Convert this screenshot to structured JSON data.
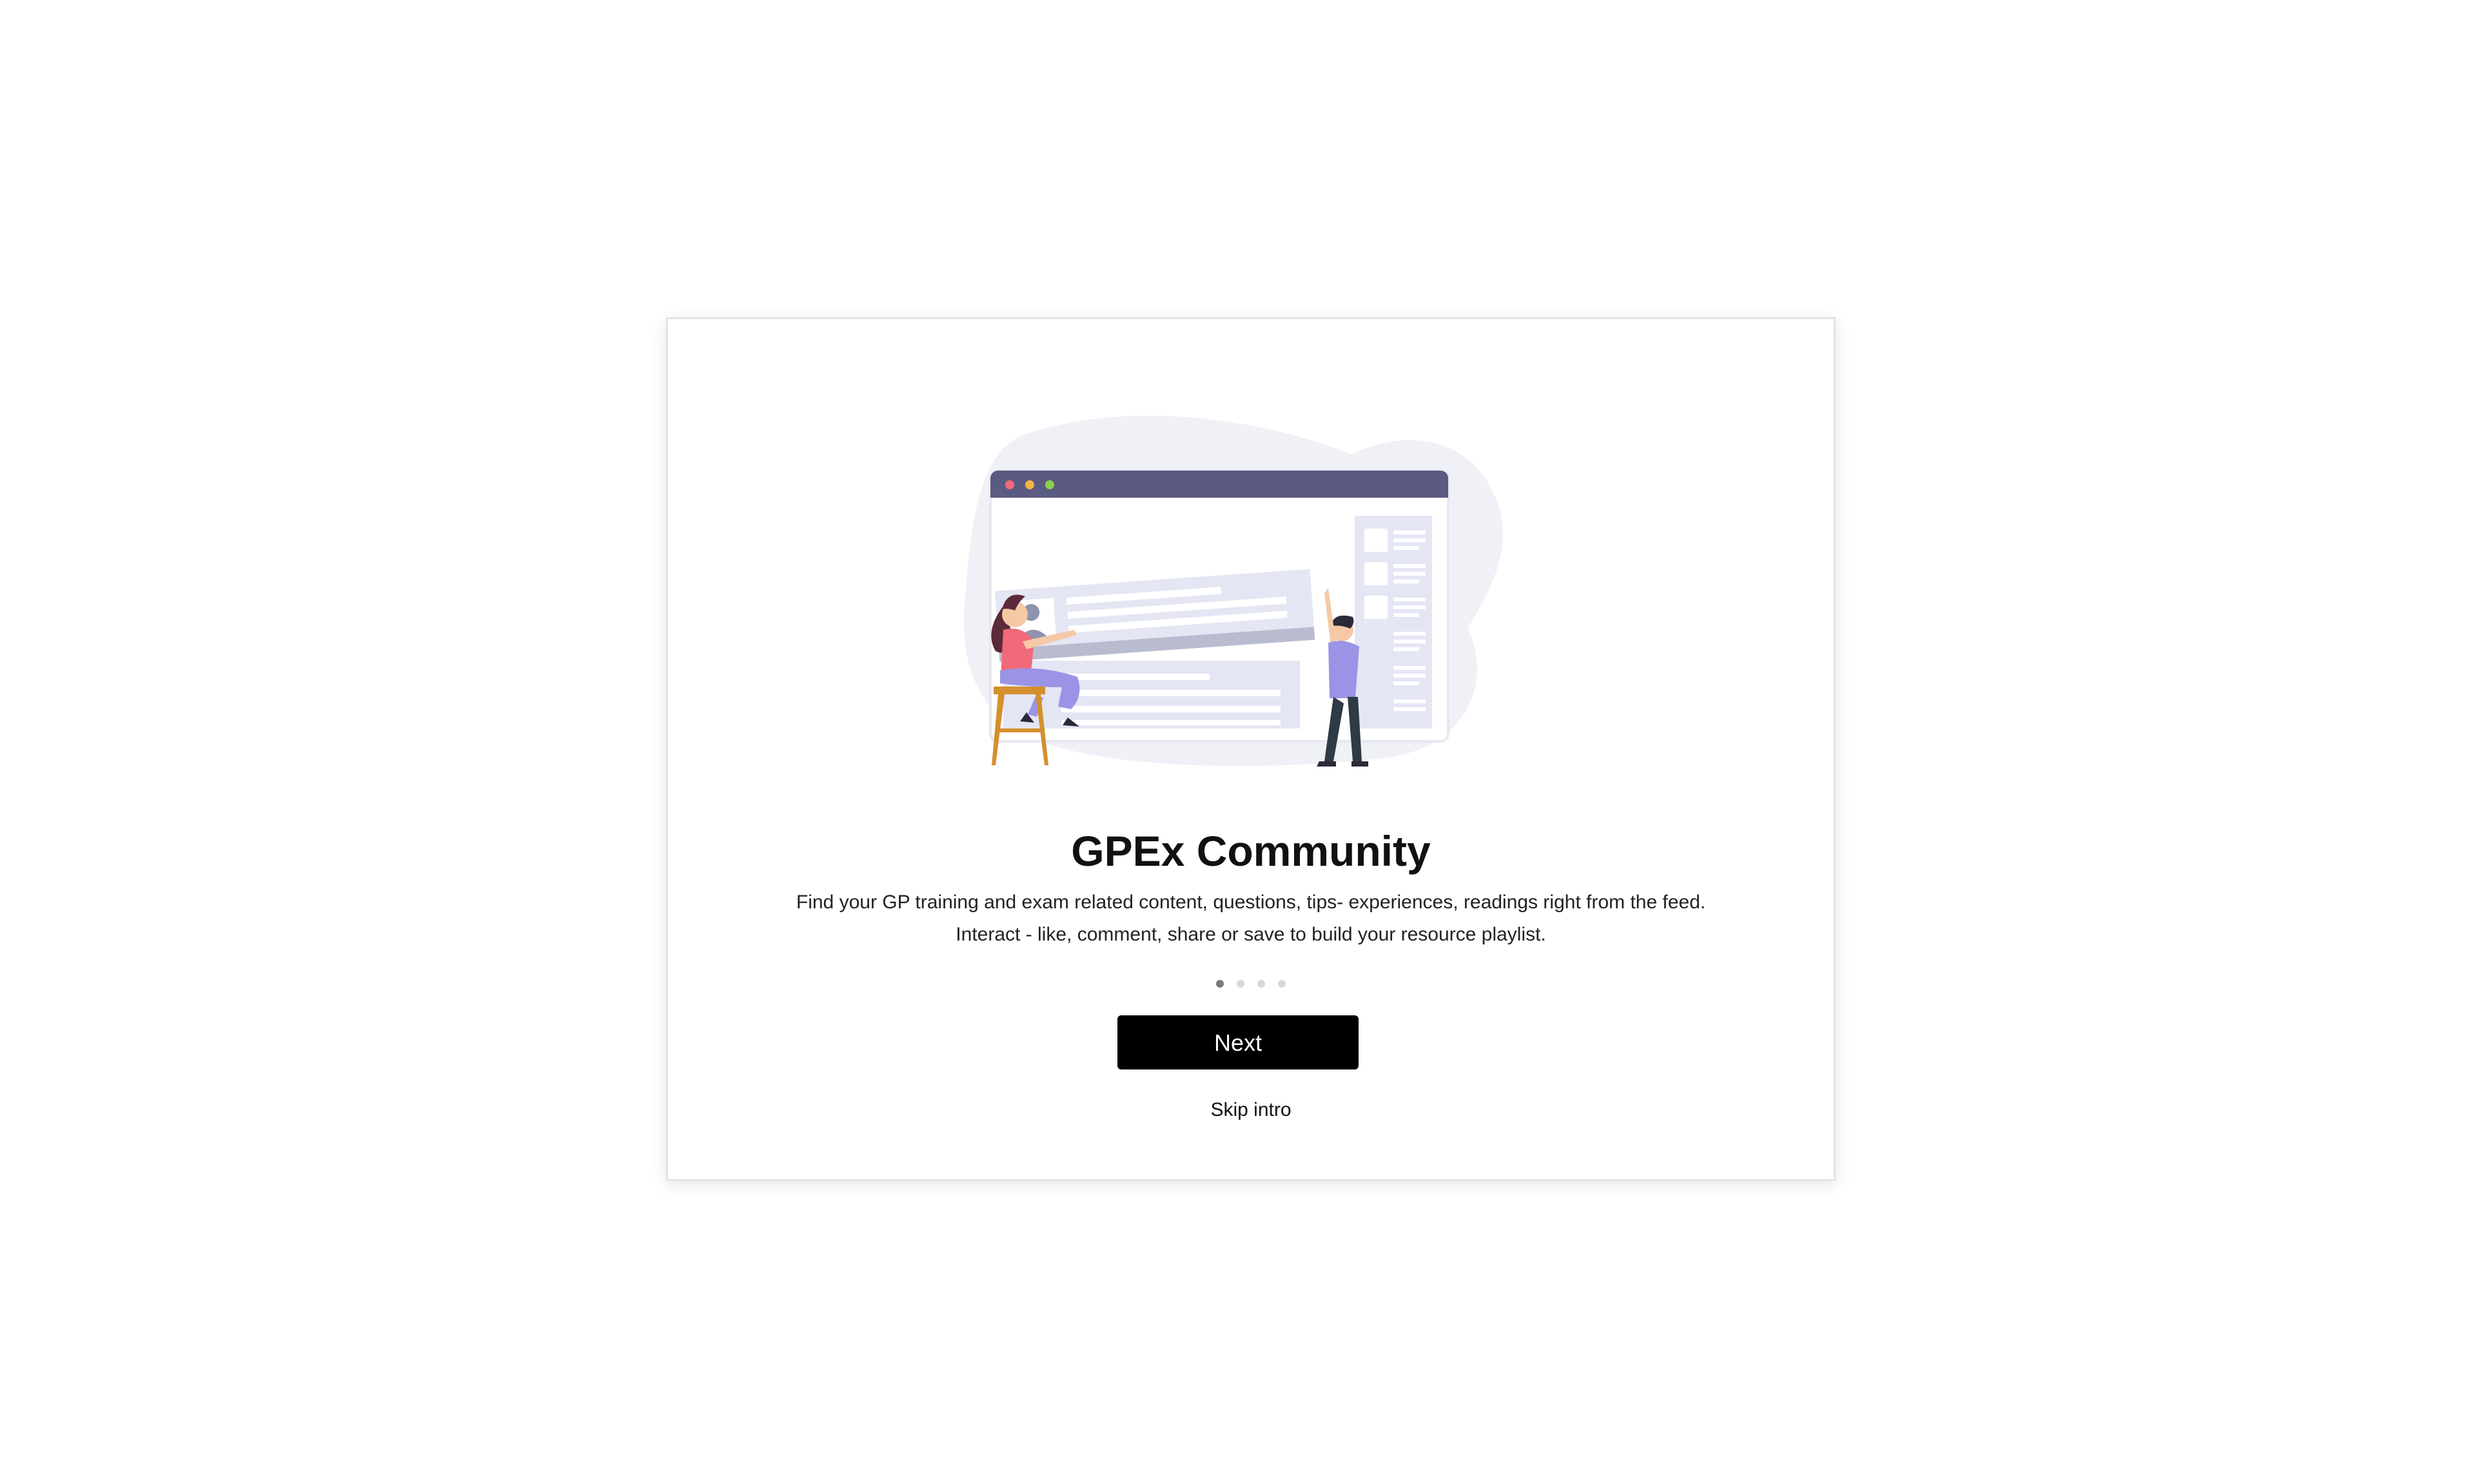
{
  "intro": {
    "title": "GPEx Community",
    "description_line1": "Find your GP training and exam related content, questions, tips- experiences, readings right from the feed.",
    "description_line2": "Interact - like, comment, share or save to build your resource playlist.",
    "pagination": {
      "total": 4,
      "active": 1
    },
    "next_label": "Next",
    "skip_label": "Skip intro",
    "illustration_icon": "community-feed-illustration"
  },
  "colors": {
    "primary_button": "#000000",
    "browser_bar": "#5a5a82",
    "accent_pink": "#f06a7a",
    "accent_yellow": "#f5b342",
    "accent_green": "#8ed04a",
    "card_lavender": "#e4e6f4",
    "figure_purple": "#9b93e6",
    "blob": "#eff1f6"
  }
}
